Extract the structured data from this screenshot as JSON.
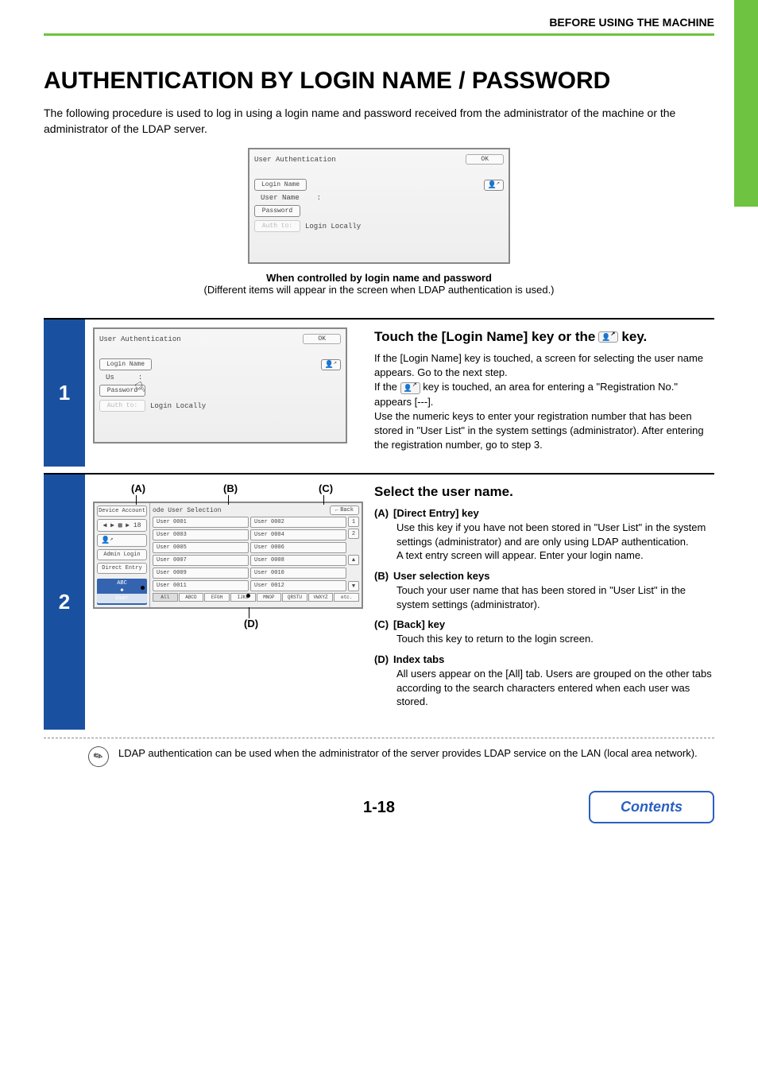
{
  "header": {
    "section": "BEFORE USING THE MACHINE"
  },
  "title": "AUTHENTICATION BY LOGIN NAME / PASSWORD",
  "intro": "The following procedure is used to log in using a login name and password received from the administrator of the machine or the administrator of the LDAP server.",
  "auth_panel": {
    "title": "User Authentication",
    "ok": "OK",
    "login_name_btn": "Login Name",
    "user_name_label": "User Name",
    "colon": ":",
    "password_btn": "Password",
    "auth_to_btn": "Auth to:",
    "auth_to_value": "Login Locally"
  },
  "caption": {
    "main": "When controlled by login name and password",
    "sub": "(Different items will appear in the screen when LDAP authentication is used.)"
  },
  "step1": {
    "num": "1",
    "heading_a": "Touch the [Login Name] key or the",
    "heading_b": "key.",
    "body1": "If the [Login Name] key is touched, a screen for selecting the user name appears. Go to the next step.",
    "body2a": "If the ",
    "body2b": " key is touched, an area for entering a \"Registration No.\" appears [---].",
    "body3": "Use the numeric keys to enter your registration number that has been stored in \"User List\" in the system settings (administrator). After entering the registration number, go to step 3."
  },
  "step2": {
    "num": "2",
    "heading": "Select the user name.",
    "labels": {
      "A": "(A)",
      "B": "(B)",
      "C": "(C)",
      "D": "(D)"
    },
    "side": {
      "device_account": "Device Account",
      "nav": "◀ ▶ ▦ ▶ 18",
      "admin_login": "Admin Login",
      "direct_entry": "Direct Entry",
      "abc": "ABC",
      "divider": "◆",
      "user": "User"
    },
    "main": {
      "title": "ode User Selection",
      "back": "Back",
      "users": [
        "User 0001",
        "User 0002",
        "User 0003",
        "User 0004",
        "User 0005",
        "User 0006",
        "User 0007",
        "User 0008",
        "User 0009",
        "User 0010",
        "User 0011",
        "User 0012"
      ],
      "scroll": [
        "1",
        "2",
        "▲",
        "▼"
      ],
      "alpha": [
        "All",
        "ABCD",
        "EFGH",
        "IJKL",
        "MNOP",
        "QRSTU",
        "VWXYZ",
        "etc."
      ]
    },
    "items": {
      "A": {
        "tag": "(A)",
        "title": "[Direct Entry] key",
        "body": "Use this key if you have not been stored in \"User List\" in the system settings (administrator) and are only using LDAP authentication.\nA text entry screen will appear. Enter your login name."
      },
      "B": {
        "tag": "(B)",
        "title": "User selection keys",
        "body": "Touch your user name that has been stored in \"User List\" in the system settings (administrator)."
      },
      "C": {
        "tag": "(C)",
        "title": "[Back] key",
        "body": "Touch this key to return to the login screen."
      },
      "D": {
        "tag": "(D)",
        "title": "Index tabs",
        "body": "All users appear on the [All] tab. Users are grouped on the other tabs according to the search characters entered when each user was stored."
      }
    }
  },
  "note": "LDAP authentication can be used when the administrator of the server provides LDAP service on the LAN (local area network).",
  "page_number": "1-18",
  "contents_btn": "Contents"
}
